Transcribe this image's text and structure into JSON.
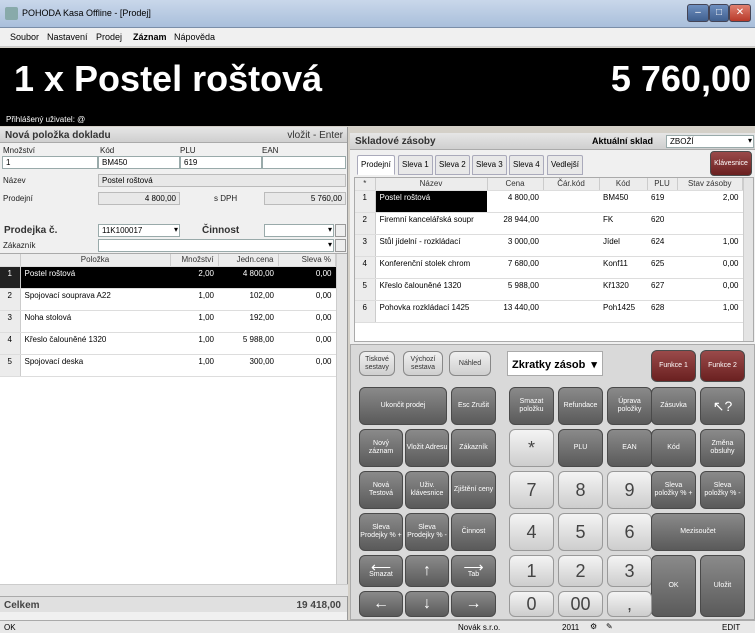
{
  "window": {
    "title": "POHODA Kasa Offline - [Prodej]",
    "min": "–",
    "max": "□",
    "close": "✕"
  },
  "menu": [
    "Soubor",
    "Nastavení",
    "Prodej",
    "Záznam",
    "Nápověda"
  ],
  "banner": {
    "item": "1 x  Postel roštová",
    "price": "5 760,00"
  },
  "user": "Přihlášený uživatel: @",
  "new_item": {
    "title": "Nová položka dokladu",
    "hint": "vložit - Enter",
    "labels": {
      "qty": "Množství",
      "code": "Kód",
      "plu": "PLU",
      "ean": "EAN",
      "name": "Název",
      "sale": "Prodejní",
      "vat": "s DPH"
    },
    "values": {
      "qty": "1",
      "code": "BM450",
      "plu": "619",
      "ean": "",
      "name": "Postel roštová",
      "sale": "4 800,00",
      "sale_vat": "5 760,00"
    }
  },
  "receipt": {
    "title": "Prodejka č.",
    "number": "11K100017",
    "activity": "Činnost",
    "customer": "Zákazník",
    "headers": [
      "Položka",
      "Množství",
      "Jedn.cena",
      "Sleva %"
    ],
    "rows": [
      {
        "n": "1",
        "item": "Postel roštová",
        "qty": "2,00",
        "price": "4 800,00",
        "disc": "0,00"
      },
      {
        "n": "2",
        "item": "Spojovací souprava A22",
        "qty": "1,00",
        "price": "102,00",
        "disc": "0,00"
      },
      {
        "n": "3",
        "item": "Noha stolová",
        "qty": "1,00",
        "price": "192,00",
        "disc": "0,00"
      },
      {
        "n": "4",
        "item": "Křeslo čalouněné 1320",
        "qty": "1,00",
        "price": "5 988,00",
        "disc": "0,00"
      },
      {
        "n": "5",
        "item": "Spojovací deska",
        "qty": "1,00",
        "price": "300,00",
        "disc": "0,00"
      }
    ],
    "total_label": "Celkem",
    "total": "19 418,00"
  },
  "stock": {
    "title": "Skladové zásoby",
    "current_label": "Aktuální sklad",
    "current": "ZBOŽÍ",
    "tabs": [
      "Prodejní",
      "Sleva 1",
      "Sleva 2",
      "Sleva 3",
      "Sleva 4",
      "Vedlejší"
    ],
    "keyboard_btn": "Klávesnice",
    "headers": [
      "Název",
      "Cena",
      "Čár.kód",
      "Kód",
      "PLU",
      "Stav zásoby"
    ],
    "rows": [
      {
        "n": "1",
        "name": "Postel roštová",
        "price": "4 800,00",
        "bar": "",
        "code": "BM450",
        "plu": "619",
        "stock": "2,00"
      },
      {
        "n": "2",
        "name": "Firemní kancelářská soupr",
        "price": "28 944,00",
        "bar": "",
        "code": "FK",
        "plu": "620",
        "stock": ""
      },
      {
        "n": "3",
        "name": "Stůl jídelní - rozkládací",
        "price": "3 000,00",
        "bar": "",
        "code": "Jídel",
        "plu": "624",
        "stock": "1,00"
      },
      {
        "n": "4",
        "name": "Konferenční stolek chrom",
        "price": "7 680,00",
        "bar": "",
        "code": "Konf11",
        "plu": "625",
        "stock": "0,00"
      },
      {
        "n": "5",
        "name": "Křeslo čalouněné 1320",
        "price": "5 988,00",
        "bar": "",
        "code": "Kř1320",
        "plu": "627",
        "stock": "0,00"
      },
      {
        "n": "6",
        "name": "Pohovka rozkládací 1425",
        "price": "13 440,00",
        "bar": "",
        "code": "Poh1425",
        "plu": "628",
        "stock": "1,00"
      }
    ]
  },
  "keys": {
    "print": "Tiskové sestavy",
    "default": "Výchozí sestava",
    "preview": "Náhled",
    "shortcuts": "Zkratky zásob",
    "f1": "Funkce 1",
    "f2": "Funkce 2",
    "end": "Ukončit prodej",
    "esc": "Esc Zrušit",
    "new": "Nový záznam",
    "addr": "Vložit Adresu",
    "cust": "Zákazník",
    "newtest": "Nová Testová",
    "userkb": "Uživ. klávesnice",
    "findprice": "Zjištění ceny",
    "discr": "Sleva Prodejky % +",
    "discr2": "Sleva Prodejky % -",
    "act": "Činnost",
    "del": "Smazat",
    "tab": "Tab",
    "delitem": "Smazat položku",
    "refund": "Refundace",
    "edititem": "Úprava položky",
    "drawer": "Zásuvka",
    "help": "↖?",
    "star": "*",
    "plu": "PLU",
    "ean": "EAN",
    "code": "Kód",
    "change": "Změna obsluhy",
    "d7": "7",
    "d8": "8",
    "d9": "9",
    "discp": "Sleva položky % +",
    "discm": "Sleva položky % -",
    "d4": "4",
    "d5": "5",
    "d6": "6",
    "subtotal": "Mezisoučet",
    "d1": "1",
    "d2": "2",
    "d3": "3",
    "d0": "0",
    "d00": "00",
    "comma": ",",
    "ok": "OK",
    "save": "Uložit"
  },
  "status": {
    "left": "OK",
    "company": "Novák s.r.o.",
    "year": "2011",
    "mode": "EDIT"
  }
}
